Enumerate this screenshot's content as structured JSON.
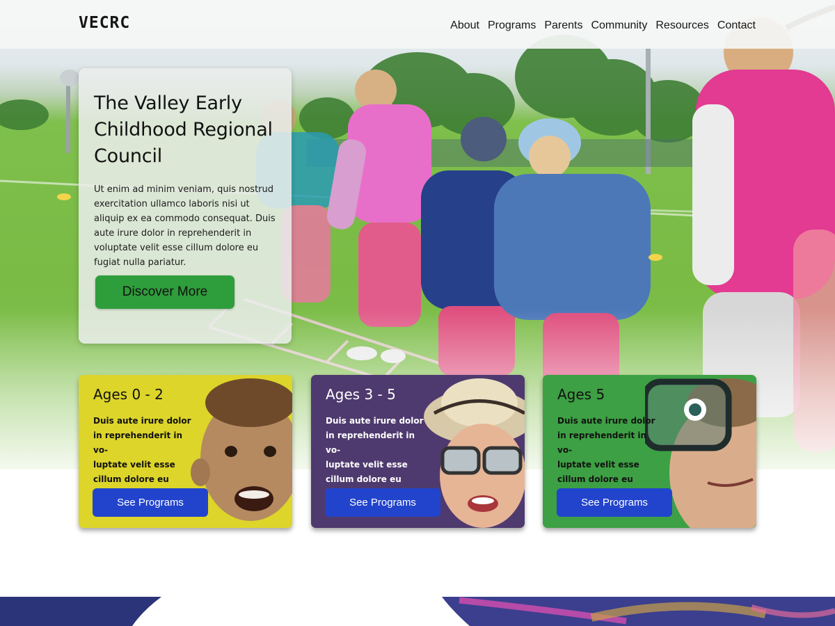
{
  "site": {
    "logo": "VECRC"
  },
  "nav": {
    "items": [
      {
        "label": "About"
      },
      {
        "label": "Programs"
      },
      {
        "label": "Parents"
      },
      {
        "label": "Community"
      },
      {
        "label": "Resources"
      },
      {
        "label": "Contact"
      }
    ]
  },
  "hero": {
    "title": "The Valley Early Childhood Regional Council",
    "text": "Ut enim ad minim veniam, quis nostrud exercitation ullamco laboris nisi ut aliquip ex ea commodo consequat. Duis aute irure dolor in reprehenderit in voluptate velit esse cillum dolore eu fugiat nulla pariatur.",
    "cta": "Discover More"
  },
  "cards": [
    {
      "title": "Ages 0 - 2",
      "text": "Duis aute irure dolor in reprehenderit in vo-\nluptate velit esse cillum dolore eu fugiat nulla pariatur.",
      "button": "See Programs",
      "color": "#ddd52a"
    },
    {
      "title": "Ages 3 - 5",
      "text": "Duis aute irure dolor in reprehenderit in vo-\nluptate velit esse cillum dolore eu fugiat nulla pariatur.",
      "button": "See Programs",
      "color": "#4e3a6e"
    },
    {
      "title": "Ages 5",
      "text": "Duis aute irure dolor in reprehenderit in vo-\nluptate velit esse cillum dolore eu fugiat nulla pariatur.",
      "button": "See Programs",
      "color": "#3da044"
    }
  ],
  "colors": {
    "accent_green": "#2e9d3b",
    "button_blue": "#2244cc",
    "band_navy": "#2b3478"
  }
}
